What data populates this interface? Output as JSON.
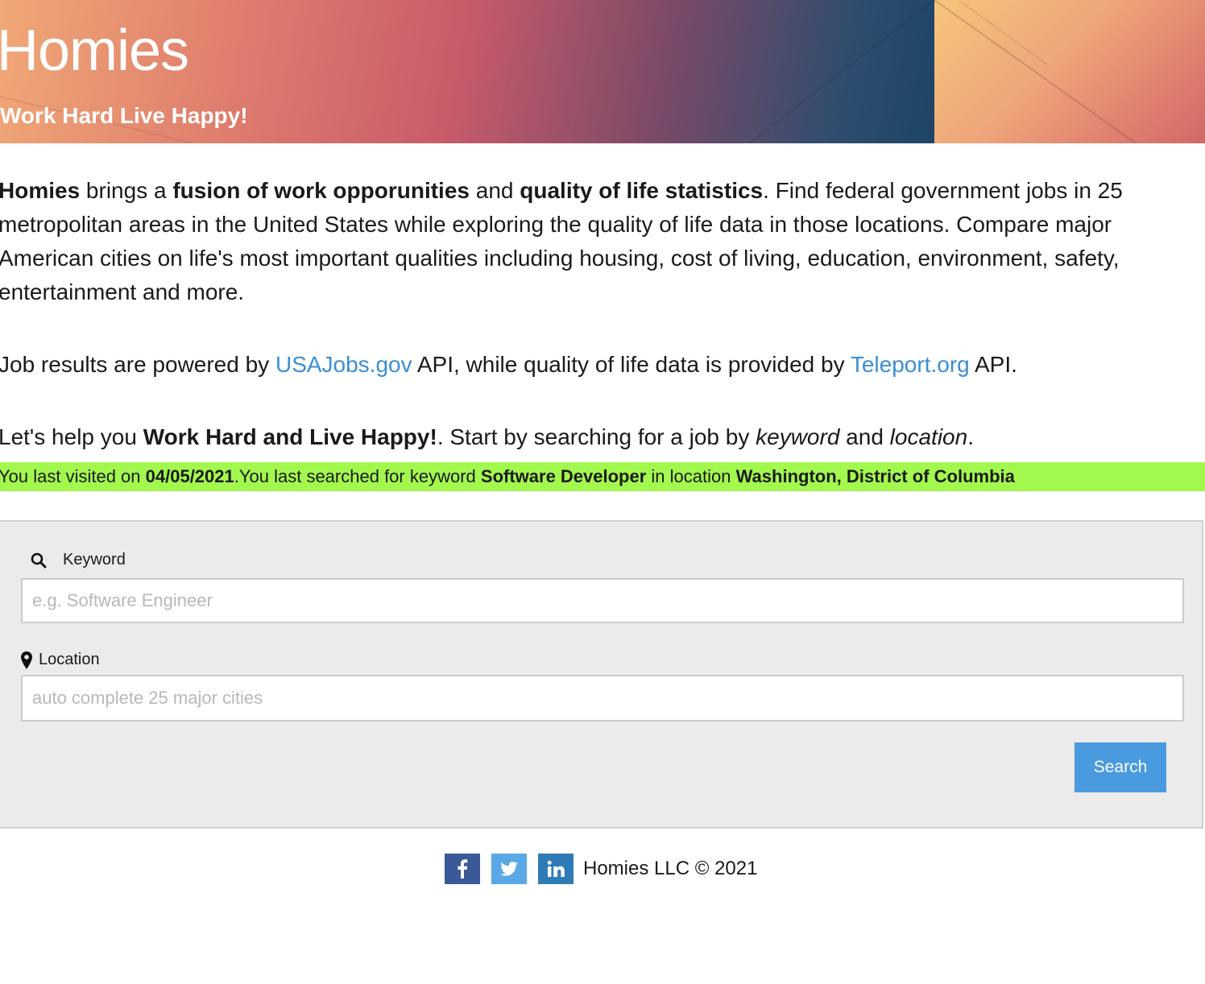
{
  "header": {
    "title": "Homies",
    "tagline": "Work Hard Live Happy!"
  },
  "intro": {
    "brand": "Homies",
    "t1": " brings a ",
    "b1": "fusion of work opporunities",
    "t2": " and ",
    "b2": "quality of life statistics",
    "t3": ". Find federal government jobs in 25 metropolitan areas in the United States while exploring the quality of life data in those locations. Compare major American cities on life's most important qualities including housing, cost of living, education, environment, safety, entertainment and more."
  },
  "powered": {
    "t1": "Job results are powered by ",
    "link1": "USAJobs.gov",
    "t2": " API, while quality of life data is provided by ",
    "link2": "Teleport.org",
    "t3": " API."
  },
  "help": {
    "t1": "Let's help you ",
    "b1": "Work Hard and Live Happy!",
    "t2": ". Start by searching for a job by ",
    "i1": "keyword",
    "t3": " and ",
    "i2": "location",
    "t4": "."
  },
  "visited": {
    "t1": "You last visited on ",
    "date": "04/05/2021",
    "t2": ".You last searched for keyword ",
    "keyword": "Software Developer",
    "t3": " in location ",
    "location": "Washington, District of Columbia"
  },
  "search": {
    "keyword_label": "Keyword",
    "keyword_placeholder": "e.g. Software Engineer",
    "keyword_value": "",
    "location_label": "Location",
    "location_placeholder": "auto complete 25 major cities",
    "location_value": "",
    "button_label": "Search",
    "keyword_icon": "search-icon",
    "location_icon": "map-marker-icon"
  },
  "footer": {
    "social": [
      "facebook-icon",
      "twitter-icon",
      "linkedin-icon"
    ],
    "copyright": "Homies LLC © 2021"
  },
  "colors": {
    "link": "#3a8fd4",
    "visited_banner": "#a3f84e",
    "search_button": "#4a9ae0",
    "facebook": "#3b5998",
    "twitter": "#5aa9e6",
    "linkedin": "#2f7bb6"
  }
}
